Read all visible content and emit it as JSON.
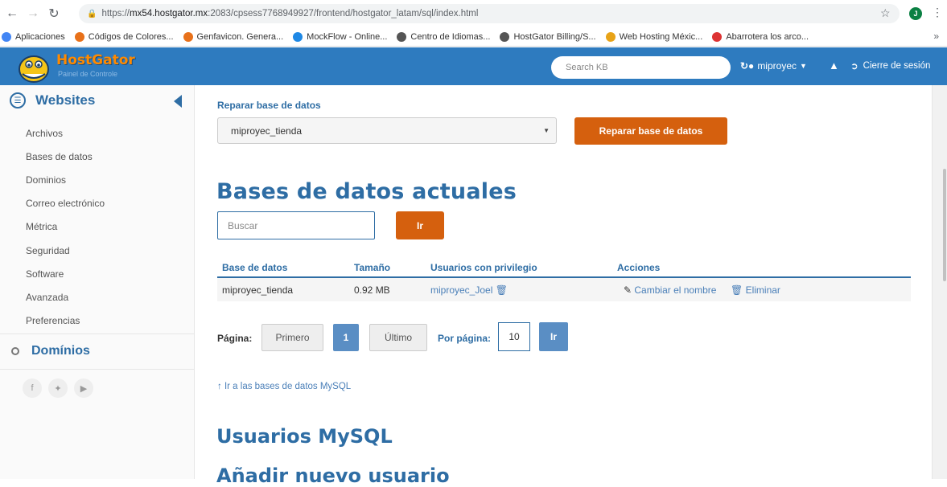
{
  "browser": {
    "url_prefix": "https://",
    "url_host": "mx54.hostgator.mx",
    "url_rest": ":2083/cpsess7768949927/frontend/hostgator_latam/sql/index.html",
    "avatar_letter": "J",
    "bookmarks": [
      {
        "label": "Aplicaciones",
        "color": "#4285f4"
      },
      {
        "label": "Códigos de Colores...",
        "color": "#e8711a"
      },
      {
        "label": "Genfavicon. Genera...",
        "color": "#e8711a"
      },
      {
        "label": "MockFlow - Online...",
        "color": "#1e88e5"
      },
      {
        "label": "Centro de Idiomas...",
        "color": "#555555"
      },
      {
        "label": "HostGator Billing/S...",
        "color": "#555555"
      },
      {
        "label": "Web Hosting Méxic...",
        "color": "#e8a317"
      },
      {
        "label": "Abarrotera los arco...",
        "color": "#d33"
      }
    ]
  },
  "header": {
    "logo_title": "HostGator",
    "logo_subtitle": "Painel de Controle",
    "search_placeholder": "Search KB",
    "username": "miproyec",
    "logout": "Cierre de sesión"
  },
  "sidebar": {
    "title": "Websites",
    "items": [
      "Archivos",
      "Bases de datos",
      "Dominios",
      "Correo electrónico",
      "Métrica",
      "Seguridad",
      "Software",
      "Avanzada",
      "Preferencias"
    ],
    "domains_title": "Domínios"
  },
  "repair": {
    "label": "Reparar base de datos",
    "selected": "miproyec_tienda",
    "button": "Reparar base de datos"
  },
  "current": {
    "title": "Bases de datos actuales",
    "search_placeholder": "Buscar",
    "go": "Ir",
    "columns": [
      "Base de datos",
      "Tamaño",
      "Usuarios con privilegio",
      "Acciones"
    ],
    "row": {
      "db": "miproyec_tienda",
      "size": "0.92 MB",
      "user": "miproyec_Joel",
      "rename": "Cambiar el nombre",
      "delete": "Eliminar"
    }
  },
  "pagination": {
    "page_label": "Página:",
    "first": "Primero",
    "current": "1",
    "last": "Último",
    "per_page_label": "Por página:",
    "per_page": "10",
    "go": "Ir"
  },
  "links": {
    "go_mysql": "Ir a las bases de datos MySQL"
  },
  "sections": {
    "users": "Usuarios MySQL",
    "add_user": "Añadir nuevo usuario"
  }
}
